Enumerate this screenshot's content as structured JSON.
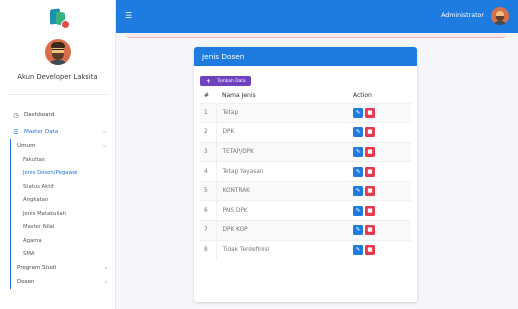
{
  "sidebar": {
    "profile_name": "Akun Developer Laksita",
    "menu": {
      "dashboard": "Dashboard",
      "master_data": "Master Data",
      "umum": "Umum",
      "umum_items": [
        "Fakultas",
        "Jenis Dosen/Pegawai",
        "Status Aktif",
        "Angkatan",
        "Jenis Matakuliah",
        "Master Nilai",
        "Agama",
        "SMA"
      ],
      "program_studi": "Program Studi",
      "dosen": "Dosen"
    }
  },
  "topbar": {
    "hamburger_icon": "menu-icon",
    "user_name": "Administrator"
  },
  "card": {
    "title": "Jenis Dosen",
    "add_button": "Tambah Data",
    "columns": {
      "no": "#",
      "nama": "Nama Jenis",
      "action": "Action"
    },
    "rows": [
      {
        "no": "1",
        "nama": "Tetap"
      },
      {
        "no": "2",
        "nama": "DPK"
      },
      {
        "no": "3",
        "nama": "TETAP/DPK"
      },
      {
        "no": "4",
        "nama": "Tetap Yayasan"
      },
      {
        "no": "5",
        "nama": "KONTRAK"
      },
      {
        "no": "6",
        "nama": "PNS DPK"
      },
      {
        "no": "7",
        "nama": "DPK KOP"
      },
      {
        "no": "8",
        "nama": "Tidak Terdefinisi"
      }
    ]
  },
  "colors": {
    "primary": "#1e7be0",
    "add_button": "#6f42c1",
    "delete": "#e53950"
  }
}
